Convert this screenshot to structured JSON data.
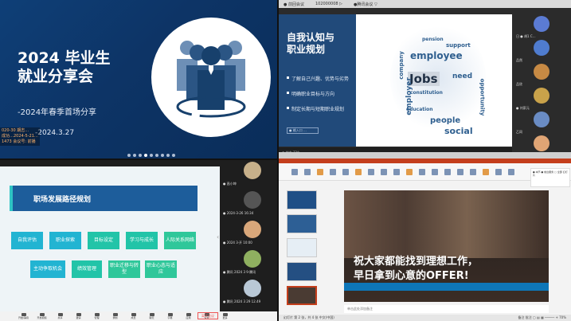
{
  "q1": {
    "title": "2024 毕业生\n就业分享会",
    "subtitle": "-2024年春季首场分享",
    "date": "-2024.3.27",
    "chatlog": [
      "020-30 期志…",
      "成功…2024-5-21…",
      "1473 会议号: 前播"
    ]
  },
  "q2": {
    "toolbar": [
      "● 前回会议",
      "102000008 ▷",
      "●腾讯会议 ▽"
    ],
    "heading": "自我认知与\n职业规划",
    "bullets": [
      "了解自己兴趣、优势与劣势",
      "明确职业目标与方向",
      "制定长期与短期职业规划"
    ],
    "input_placeholder": "● 输入口 ...",
    "cloud_words": [
      {
        "w": "employee"
      },
      {
        "w": "Jobs"
      },
      {
        "w": "need"
      },
      {
        "w": "people"
      },
      {
        "w": "social"
      },
      {
        "w": "company"
      },
      {
        "w": "pension"
      },
      {
        "w": "support"
      },
      {
        "w": "employer"
      },
      {
        "w": "constitution"
      },
      {
        "w": "education"
      },
      {
        "w": "opportunity"
      }
    ],
    "participants": [
      {
        "name": "日 ● 胡1 C…",
        "color": "#5b7bd3"
      },
      {
        "name": "品然",
        "color": "#4f7ccf"
      },
      {
        "name": "品欣",
        "color": "#c78a44"
      },
      {
        "name": "● 刘家元",
        "color": "#c9a24a"
      },
      {
        "name": "乙同",
        "color": "#6a8cc4"
      },
      {
        "name": "日 ● 林志斌",
        "color": "#e0a575"
      }
    ],
    "bottom_text": "● 林志 下拉 ··· ▸"
  },
  "q3": {
    "banner_title": "职场发展路径规划",
    "boxes": [
      {
        "label": "自我评估",
        "color": "#22b4d2"
      },
      {
        "label": "职业探索",
        "color": "#22b4d2"
      },
      {
        "label": "目标设定",
        "color": "#22c4a8"
      },
      {
        "label": "学习与成长",
        "color": "#22c4a8"
      },
      {
        "label": "人际关系网络",
        "color": "#2fc79a"
      },
      {
        "label": "主动争取机会",
        "color": "#22b4d2"
      },
      {
        "label": "绩效管理",
        "color": "#22c4a8"
      },
      {
        "label": "职业迁移与转型",
        "color": "#2fc79a"
      },
      {
        "label": "职业心态与适应",
        "color": "#2fc79a"
      }
    ],
    "participants": [
      {
        "name": "● 昌小坤",
        "color": "#c7b08a"
      },
      {
        "name": "● 2024-3-26 16:34",
        "color": "#555555"
      },
      {
        "name": "● 2024 3·开 10:00",
        "color": "#d9a77a"
      },
      {
        "name": "● 腾讯 2024 3 9·腾讯",
        "color": "#8fb060"
      },
      {
        "name": "● 腾讯 2024 3 29 12.49",
        "color": "#b9c8d6"
      }
    ],
    "controls": [
      "开始/静音",
      "开启视频",
      "共享",
      "邀请",
      "管理",
      "录制",
      "成员",
      "聊天",
      "字幕",
      "应用",
      "设置",
      "更多"
    ],
    "leave_label": "离开会议"
  },
  "q4": {
    "caption1": "祝大家都能找到理想工作，",
    "caption2": "早日拿到心意的OFFER!",
    "notes": "单击此处添加备注",
    "status_left": "幻灯片 第 2 张，共 4 张   中文(中国)",
    "status_right": "备注  批注   ▢ ▤ ▦  ─────  +  70%",
    "panel_text": "● 本节 ● 前台服务 ▢ 全部 幻灯片"
  }
}
